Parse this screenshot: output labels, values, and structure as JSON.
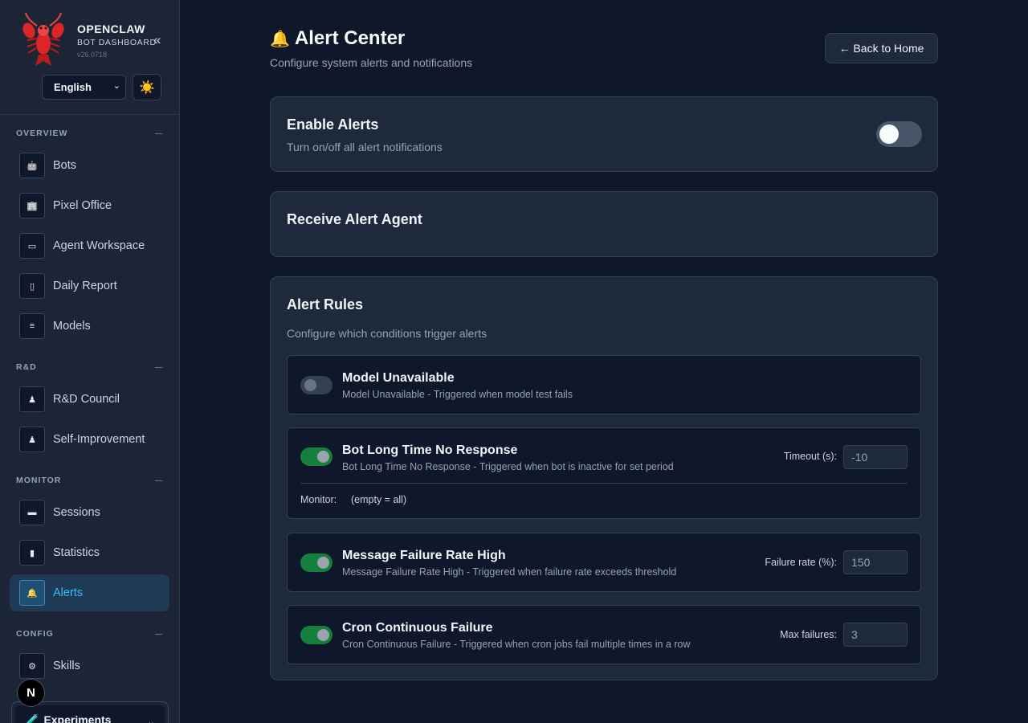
{
  "brand": {
    "name": "OPENCLAW",
    "subtitle": "BOT DASHBOARD",
    "version": "v26.0718",
    "collapse_glyph": "«",
    "logo_icon": "lobster-icon",
    "language": "English",
    "theme_icon": "☀️"
  },
  "sidebar": {
    "sections": [
      {
        "title": "OVERVIEW",
        "items": [
          {
            "label": "Bots",
            "icon": "robot-icon"
          },
          {
            "label": "Pixel Office",
            "icon": "office-icon"
          },
          {
            "label": "Agent Workspace",
            "icon": "workspace-icon"
          },
          {
            "label": "Daily Report",
            "icon": "report-icon"
          },
          {
            "label": "Models",
            "icon": "model-icon"
          }
        ]
      },
      {
        "title": "R&D",
        "items": [
          {
            "label": "R&D Council",
            "icon": "council-icon"
          },
          {
            "label": "Self-Improvement",
            "icon": "improve-icon"
          }
        ]
      },
      {
        "title": "MONITOR",
        "items": [
          {
            "label": "Sessions",
            "icon": "chat-icon"
          },
          {
            "label": "Statistics",
            "icon": "chart-icon"
          },
          {
            "label": "Alerts",
            "icon": "bell-icon",
            "active": true
          }
        ]
      },
      {
        "title": "CONFIG",
        "items": [
          {
            "label": "Skills",
            "icon": "skills-icon"
          }
        ]
      }
    ],
    "experiments": {
      "icon": "🧪",
      "label": "Experiments"
    },
    "fab_letter": "N"
  },
  "header": {
    "icon": "🔔",
    "title": "Alert Center",
    "subtitle": "Configure system alerts and notifications",
    "back_label": "← Back to Home"
  },
  "enable_alerts": {
    "title": "Enable Alerts",
    "description": "Turn on/off all alert notifications",
    "enabled": false
  },
  "receive_agent": {
    "title": "Receive Alert Agent"
  },
  "alert_rules": {
    "title": "Alert Rules",
    "description": "Configure which conditions trigger alerts",
    "rules": [
      {
        "title": "Model Unavailable",
        "description": "Model Unavailable - Triggered when model test fails",
        "enabled": false
      },
      {
        "title": "Bot Long Time No Response",
        "description": "Bot Long Time No Response - Triggered when bot is inactive for set period",
        "enabled": true,
        "param_label": "Timeout (s):",
        "param_value": "-10",
        "monitor_label": "Monitor:",
        "monitor_value": "(empty = all)"
      },
      {
        "title": "Message Failure Rate High",
        "description": "Message Failure Rate High - Triggered when failure rate exceeds threshold",
        "enabled": true,
        "param_label": "Failure rate (%):",
        "param_value": "150"
      },
      {
        "title": "Cron Continuous Failure",
        "description": "Cron Continuous Failure - Triggered when cron jobs fail multiple times in a row",
        "enabled": true,
        "param_label": "Max failures:",
        "param_value": "3"
      }
    ]
  },
  "colors": {
    "bg": "#0f172a",
    "sidebar": "#1b2536",
    "card": "#1e293b",
    "accent": "#38bdf8",
    "toggle_on": "#15803d"
  }
}
